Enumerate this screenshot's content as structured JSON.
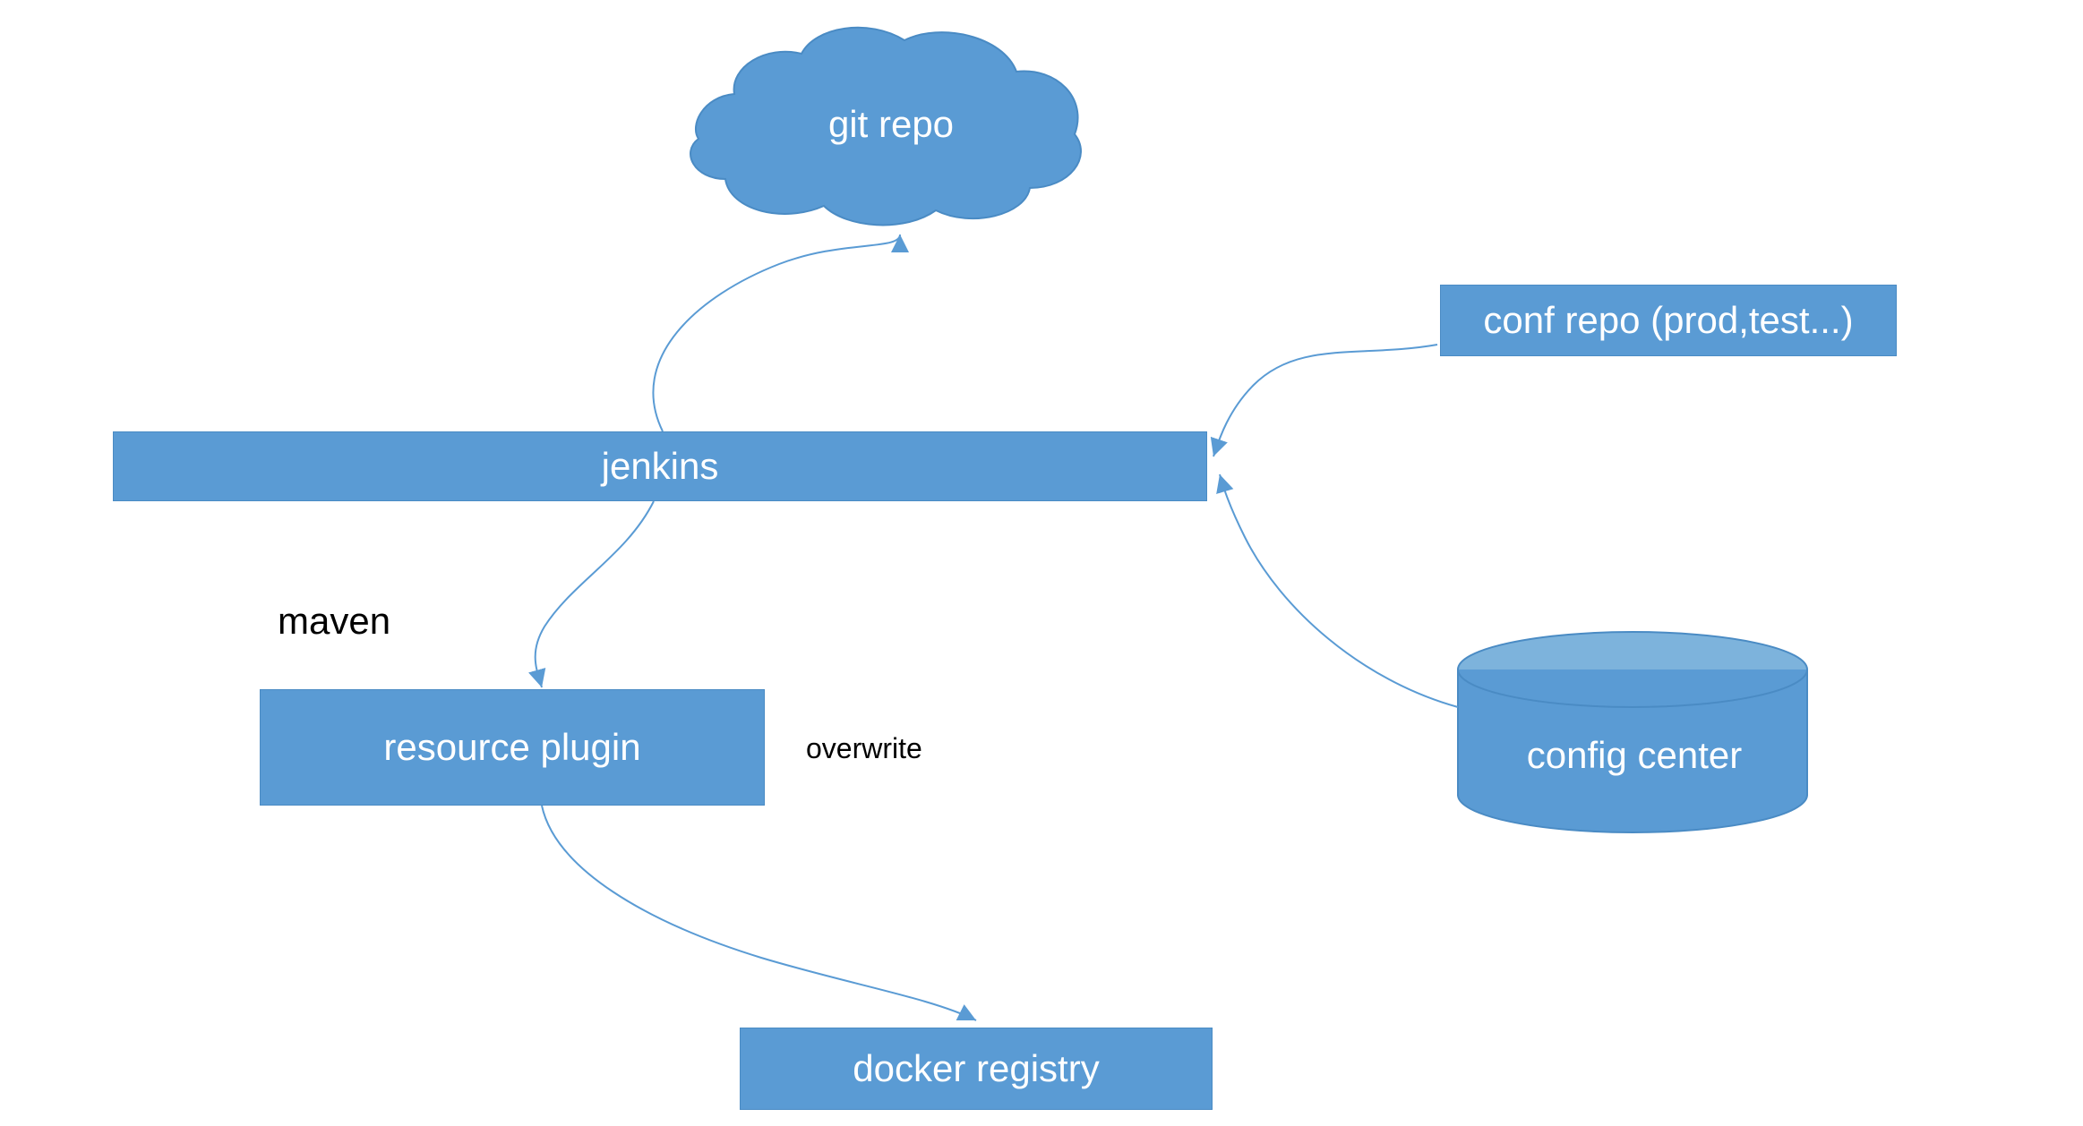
{
  "nodes": {
    "git_repo": "git repo",
    "jenkins": "jenkins",
    "conf_repo": "conf repo (prod,test...)",
    "resource_plugin": "resource plugin",
    "config_center": "config center",
    "docker_registry": "docker registry"
  },
  "labels": {
    "maven": "maven",
    "overwrite": "overwrite"
  },
  "colors": {
    "shape_fill": "#5a9bd4",
    "shape_stroke": "#4a8bc4",
    "connector": "#5a9bd4",
    "text_on_shape": "#ffffff",
    "text_label": "#000000"
  },
  "edges": [
    {
      "from": "jenkins",
      "to": "git_repo",
      "label": null
    },
    {
      "from": "jenkins",
      "to": "resource_plugin",
      "label": "maven"
    },
    {
      "from": "conf_repo",
      "to": "jenkins",
      "label": null
    },
    {
      "from": "config_center",
      "to": "jenkins",
      "label": null
    },
    {
      "from": "resource_plugin",
      "to": "docker_registry",
      "label": "overwrite"
    }
  ]
}
